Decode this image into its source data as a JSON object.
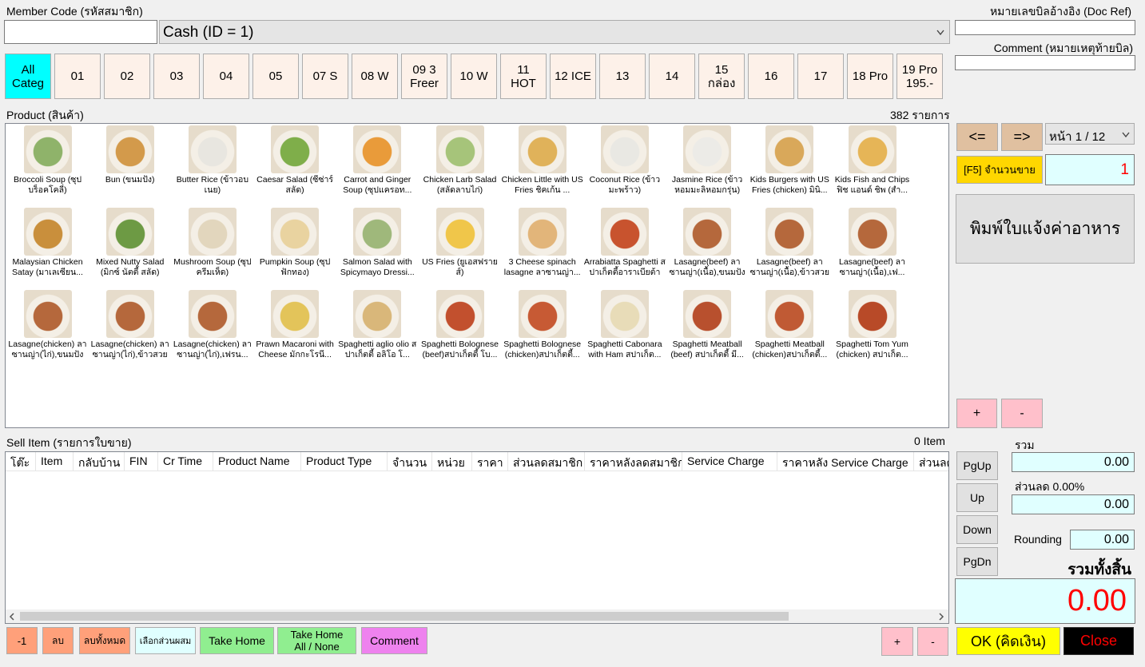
{
  "header": {
    "member_code_label": "Member Code (รหัสสมาชิก)",
    "member_code_value": "",
    "payment_selected": "Cash (ID = 1)",
    "doc_ref_label": "หมายเลขบิลอ้างอิง (Doc Ref)",
    "doc_ref_value": "",
    "comment_label": "Comment (หมายเหตุท้ายบิล)",
    "comment_value": ""
  },
  "categories": [
    {
      "label": "All\nCateg",
      "active": true
    },
    {
      "label": "01"
    },
    {
      "label": "02"
    },
    {
      "label": "03"
    },
    {
      "label": "04"
    },
    {
      "label": "05"
    },
    {
      "label": "07 S"
    },
    {
      "label": "08 W"
    },
    {
      "label": "09 3\nFreer"
    },
    {
      "label": "10 W"
    },
    {
      "label": "11\nHOT"
    },
    {
      "label": "12 ICE"
    },
    {
      "label": "13"
    },
    {
      "label": "14"
    },
    {
      "label": "15\nกล่อง"
    },
    {
      "label": "16"
    },
    {
      "label": "17"
    },
    {
      "label": "18 Pro"
    },
    {
      "label": "19 Pro\n195.-"
    }
  ],
  "products": {
    "label": "Product (สินค้า)",
    "count": "382 รายการ",
    "items": [
      {
        "name": "Broccoli Soup (ซุปบร็อคโคลี่)",
        "color": "#8fb36a"
      },
      {
        "name": "Bun (ขนมปัง)",
        "color": "#d39a4b"
      },
      {
        "name": "Butter Rice (ข้าวอบเนย)",
        "color": "#e8e6e0"
      },
      {
        "name": "Caesar Salad (ซีซ่าร์สลัด)",
        "color": "#7fae4a"
      },
      {
        "name": "Carrot and Ginger Soup (ซุปแครอท...",
        "color": "#e99b3a"
      },
      {
        "name": "Chicken Larb Salad (สลัดลาบไก่)",
        "color": "#a6c47a"
      },
      {
        "name": "Chicken Little with US Fries ชิคเก้น ...",
        "color": "#e0b25a"
      },
      {
        "name": "Coconut Rice (ข้าวมะพร้าว)",
        "color": "#e9e8e3"
      },
      {
        "name": "Jasmine Rice (ข้าวหอมมะลิหอมกรุ่น)",
        "color": "#ecebe7"
      },
      {
        "name": "Kids Burgers with US Fries (chicken) มินิ...",
        "color": "#d9a85a"
      },
      {
        "name": "Kids Fish and Chips ฟิช แอนด์ ชิพ (สำ...",
        "color": "#e6b557"
      },
      {
        "name": "Malaysian Chicken Satay (มาเลเซียน...",
        "color": "#c98f3c"
      },
      {
        "name": "Mixed Nutty Salad (มิกซ์ นัตตี้ สลัด)",
        "color": "#6d9a44"
      },
      {
        "name": "Mushroom Soup (ซุปครีมเห็ด)",
        "color": "#e2d6bd"
      },
      {
        "name": "Pumpkin Soup (ซุปฟักทอง)",
        "color": "#e9d3a0"
      },
      {
        "name": "Salmon Salad with Spicymayo Dressi...",
        "color": "#9fb87b"
      },
      {
        "name": "US Fries (ยูเอสฟรายส์)",
        "color": "#f0c64a"
      },
      {
        "name": "3 Cheese spinach lasagne ลาซานญ่า...",
        "color": "#e2b57a"
      },
      {
        "name": "Arrabiatta Spaghetti สปาเก็ตตี้อาราเบียต้า",
        "color": "#c8532e"
      },
      {
        "name": "Lasagne(beef) ลาซานญ่า(เนื้อ),ขนมปัง",
        "color": "#b5683c"
      },
      {
        "name": "Lasagne(beef) ลาซานญ่า(เนื้อ),ข้าวสวย",
        "color": "#b5683c"
      },
      {
        "name": "Lasagne(beef) ลาซานญ่า(เนื้อ),เฟ...",
        "color": "#b5683c"
      },
      {
        "name": "Lasagne(chicken) ลาซานญ่า(ไก่),ขนมปัง",
        "color": "#b5683c"
      },
      {
        "name": "Lasagne(chicken) ลาซานญ่า(ไก่),ข้าวสวย",
        "color": "#b5683c"
      },
      {
        "name": "Lasagne(chicken) ลาซานญ่า(ไก่),เฟรน...",
        "color": "#b5683c"
      },
      {
        "name": "Prawn Macaroni with Cheese มักกะโรนี...",
        "color": "#e3c45a"
      },
      {
        "name": "Spaghetti aglio olio สปาเก็ตตี้ อลิโอ โ...",
        "color": "#d9b77a"
      },
      {
        "name": "Spaghetti Bolognese (beef)สปาเก็ตตี้ โบ...",
        "color": "#c2502e"
      },
      {
        "name": "Spaghetti Bolognese (chicken)สปาเก็ตตี้...",
        "color": "#c75a34"
      },
      {
        "name": "Spaghetti Cabonara with Ham สปาเก็ต...",
        "color": "#e8dcb8"
      },
      {
        "name": "Spaghetti Meatball (beef) สปาเก็ตตี้ มี...",
        "color": "#b8502e"
      },
      {
        "name": "Spaghetti Meatball (chicken)สปาเก็ตตี้...",
        "color": "#c05a34"
      },
      {
        "name": "Spaghetti Tom Yum (chicken) สปาเก็ต...",
        "color": "#b84a28"
      }
    ]
  },
  "nav": {
    "prev": "<=",
    "next": "=>",
    "page": "หน้า 1 / 12",
    "qty_button": "[F5] จำนวนขาย",
    "qty_value": "1",
    "print_button": "พิมพ์ใบแจ้งค่าอาหาร",
    "plus": "+",
    "minus": "-"
  },
  "sell": {
    "label": "Sell Item (รายการใบขาย)",
    "count": "0 Item",
    "columns": [
      "โต๊ะ",
      "Item",
      "กลับบ้าน",
      "FIN",
      "Cr Time",
      "Product Name",
      "Product Type",
      "จำนวน",
      "หน่วย",
      "ราคา",
      "ส่วนลดสมาชิก",
      "ราคาหลังลดสมาชิก",
      "Service Charge",
      "ราคาหลัง Service Charge",
      "ส่วนลด"
    ]
  },
  "scroll": {
    "pgup": "PgUp",
    "up": "Up",
    "down": "Down",
    "pgdn": "PgDn"
  },
  "totals": {
    "sum_label": "รวม",
    "sum_value": "0.00",
    "discount_label": "ส่วนลด 0.00%",
    "discount_value": "0.00",
    "rounding_label": "Rounding",
    "rounding_value": "0.00",
    "grand_label": "รวมทั้งสิ้น",
    "grand_value": "0.00"
  },
  "actions": {
    "minus_one": "-1",
    "delete": "ลบ",
    "delete_all": "ลบทั้งหมด",
    "select_mix": "เลือกส่วนผสม",
    "take_home": "Take Home",
    "take_home_all": "Take Home\nAll / None",
    "comment": "Comment",
    "plus": "+",
    "minus": "-",
    "ok": "OK (คิดเงิน)",
    "close": "Close"
  },
  "colors": {
    "active_category": "#00ffff",
    "category_bg": "#fdf1e9",
    "nav_button": "#e0c0a0",
    "qty_button": "#ffd700",
    "plus_minus": "#ffc0cb",
    "ok": "#ffff00",
    "close_bg": "#000000",
    "close_text": "#ff0000",
    "grand_total_text": "#ff0000",
    "total_box": "#e0ffff",
    "take_home": "#90ee90",
    "comment": "#ee82ee",
    "delete": "#ffa07a"
  }
}
